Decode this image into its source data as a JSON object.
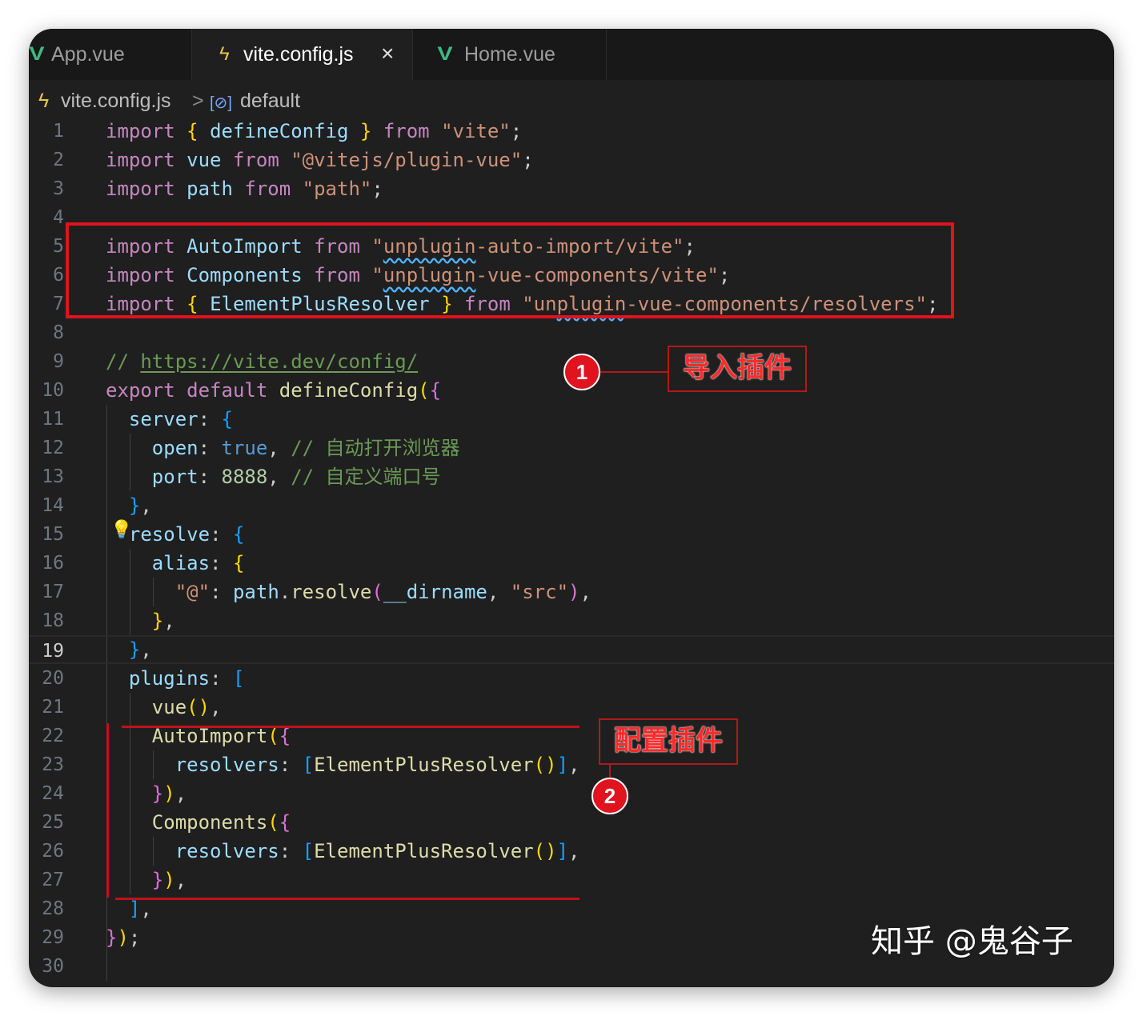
{
  "tabs": [
    {
      "label": "App.vue",
      "icon": "vue-icon"
    },
    {
      "label": "vite.config.js",
      "icon": "bolt-icon",
      "active": true
    },
    {
      "label": "Home.vue",
      "icon": "vue-icon"
    }
  ],
  "breadcrumb": {
    "file": "vite.config.js",
    "separator": ">",
    "symbol": "default"
  },
  "code_lines": [
    "import { defineConfig } from \"vite\";",
    "import vue from \"@vitejs/plugin-vue\";",
    "import path from \"path\";",
    "",
    "import AutoImport from \"unplugin-auto-import/vite\";",
    "import Components from \"unplugin-vue-components/vite\";",
    "import { ElementPlusResolver } from \"unplugin-vue-components/resolvers\";",
    "",
    "// https://vite.dev/config/",
    "export default defineConfig({",
    "  server: {",
    "    open: true, // 自动打开浏览器",
    "    port: 8888, // 自定义端口号",
    "  },",
    "  resolve: {",
    "    alias: {",
    "      \"@\": path.resolve(__dirname, \"src\"),",
    "    },",
    "  },",
    "  plugins: [",
    "    vue(),",
    "    AutoImport({",
    "      resolvers: [ElementPlusResolver()],",
    "    }),",
    "    Components({",
    "      resolvers: [ElementPlusResolver()],",
    "    }),",
    "  ],",
    "});",
    ""
  ],
  "current_line": 19,
  "annotations": [
    {
      "badge": "1",
      "label": "导入插件"
    },
    {
      "badge": "2",
      "label": "配置插件"
    }
  ],
  "watermark": "知乎 @鬼谷子",
  "colors": {
    "editor_bg": "#1f1f1f",
    "keyword": "#c586c0",
    "string": "#ce9178",
    "variable": "#9cdcfe",
    "comment": "#6a9955",
    "annotation_red": "#e0131e"
  }
}
